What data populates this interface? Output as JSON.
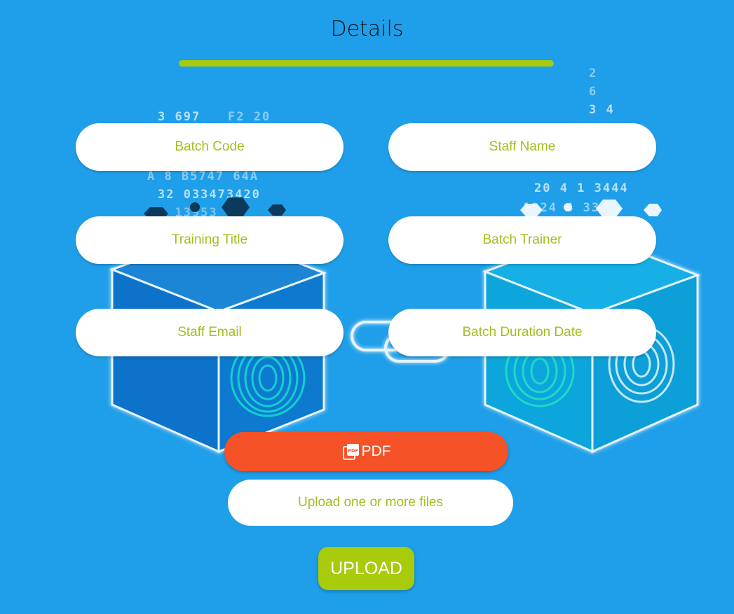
{
  "page": {
    "title": "Details"
  },
  "colors": {
    "background": "#1f9fe9",
    "accent": "#a8cb0b",
    "pdf_button": "#f65228",
    "field_text": "#a3bf1c"
  },
  "form": {
    "fields": [
      {
        "placeholder": "Batch Code",
        "value": ""
      },
      {
        "placeholder": "Staff Name",
        "value": ""
      },
      {
        "placeholder": "Training Title",
        "value": ""
      },
      {
        "placeholder": "Batch Trainer",
        "value": ""
      },
      {
        "placeholder": "Staff Email",
        "value": ""
      },
      {
        "placeholder": "Batch Duration Date",
        "value": ""
      }
    ],
    "pdf_button": {
      "label": "PDF",
      "icon": "pdf-file-icon"
    },
    "file_upload": {
      "label": "Upload one or more files"
    },
    "submit_button": {
      "label": "UPLOAD"
    }
  }
}
